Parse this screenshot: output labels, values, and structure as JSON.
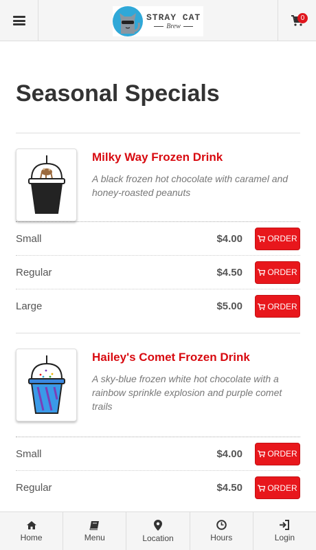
{
  "header": {
    "brand_line1": "STRAY CAT",
    "brand_line2": "Brew",
    "cart_count": "0"
  },
  "page": {
    "title": "Seasonal Specials"
  },
  "products": [
    {
      "name": "Milky Way Frozen Drink",
      "description": "A black frozen hot chocolate with caramel and honey-roasted peanuts",
      "options": [
        {
          "size": "Small",
          "price": "$4.00",
          "button": "ORDER"
        },
        {
          "size": "Regular",
          "price": "$4.50",
          "button": "ORDER"
        },
        {
          "size": "Large",
          "price": "$5.00",
          "button": "ORDER"
        }
      ]
    },
    {
      "name": "Hailey's Comet Frozen Drink",
      "description": "A sky-blue frozen white hot chocolate with a rainbow sprinkle explosion and purple comet trails",
      "options": [
        {
          "size": "Small",
          "price": "$4.00",
          "button": "ORDER"
        },
        {
          "size": "Regular",
          "price": "$4.50",
          "button": "ORDER"
        }
      ]
    }
  ],
  "bottom_nav": [
    {
      "label": "Home",
      "icon": "home-icon"
    },
    {
      "label": "Menu",
      "icon": "book-icon"
    },
    {
      "label": "Location",
      "icon": "map-marker-icon"
    },
    {
      "label": "Hours",
      "icon": "clock-icon"
    },
    {
      "label": "Login",
      "icon": "login-icon"
    }
  ],
  "colors": {
    "accent": "#e8171c",
    "product_name": "#d80a10",
    "bar_bg": "#f5f5f5",
    "logo_circle": "#2fa8d8"
  }
}
